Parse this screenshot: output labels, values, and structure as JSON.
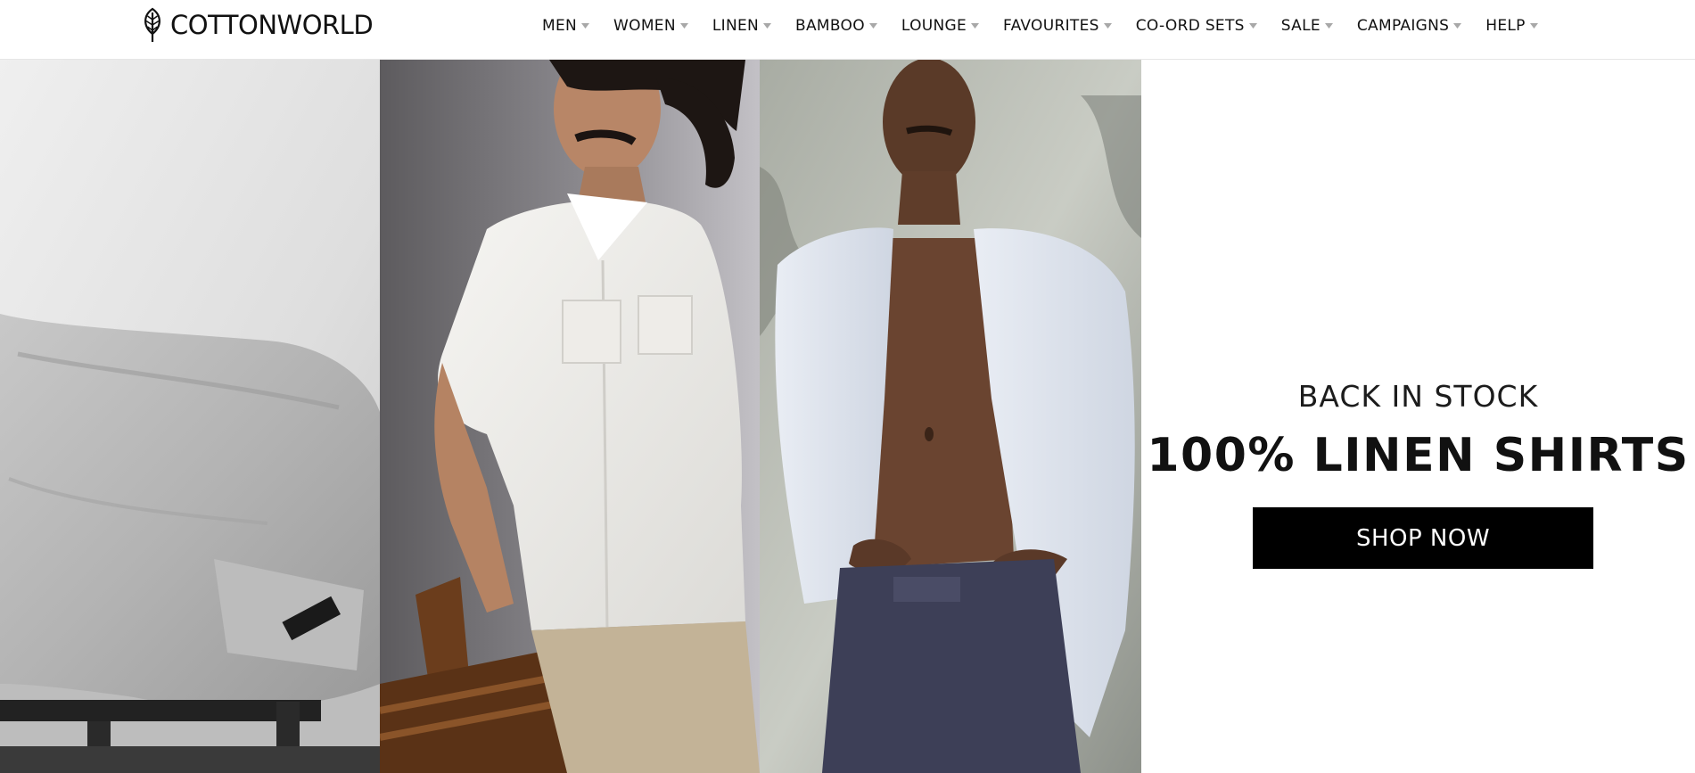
{
  "brand": {
    "name": "COTTONWORLD",
    "logo_icon": "leaf-icon"
  },
  "nav": {
    "items": [
      {
        "label": "MEN"
      },
      {
        "label": "WOMEN"
      },
      {
        "label": "LINEN"
      },
      {
        "label": "BAMBOO"
      },
      {
        "label": "LOUNGE"
      },
      {
        "label": "FAVOURITES"
      },
      {
        "label": "CO-ORD SETS"
      },
      {
        "label": "SALE"
      },
      {
        "label": "CAMPAIGNS"
      },
      {
        "label": "HELP"
      }
    ],
    "dropdown_icon": "chevron-down-icon"
  },
  "hero": {
    "eyebrow": "BACK IN STOCK",
    "title": "100% LINEN SHIRTS",
    "cta_label": "SHOP NOW"
  },
  "colors": {
    "text": "#111111",
    "cta_background": "#000000",
    "cta_text": "#ffffff",
    "caret": "#a8a8a8"
  }
}
